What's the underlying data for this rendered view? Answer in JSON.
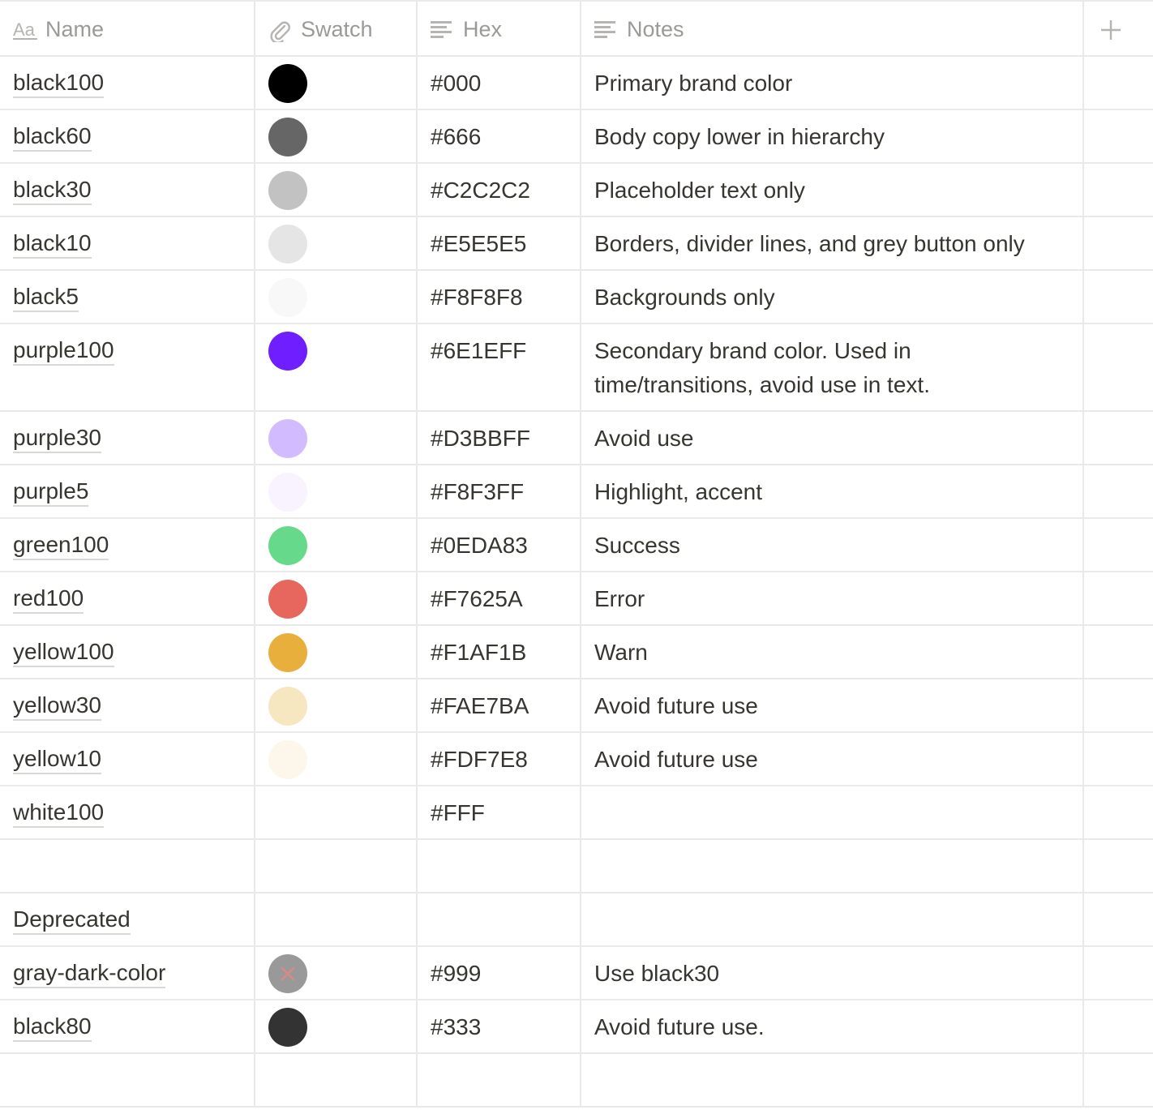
{
  "columns": {
    "name": "Name",
    "swatch": "Swatch",
    "hex": "Hex",
    "notes": "Notes"
  },
  "icons": {
    "name": "text-type-icon",
    "swatch": "paperclip-icon",
    "hex": "text-lines-icon",
    "notes": "text-lines-icon",
    "add": "plus-icon"
  },
  "rows": [
    {
      "name": "black100",
      "hex": "#000",
      "notes": "Primary brand color",
      "swatch": "#000000"
    },
    {
      "name": "black60",
      "hex": "#666",
      "notes": "Body copy lower in hierarchy",
      "swatch": "#666666"
    },
    {
      "name": "black30",
      "hex": "#C2C2C2",
      "notes": "Placeholder text only",
      "swatch": "#C2C2C2"
    },
    {
      "name": "black10",
      "hex": "#E5E5E5",
      "notes": "Borders, divider lines, and grey button only",
      "swatch": "#E5E5E5"
    },
    {
      "name": "black5",
      "hex": "#F8F8F8",
      "notes": "Backgrounds only",
      "swatch": "#F8F8F8"
    },
    {
      "name": "purple100",
      "hex": "#6E1EFF",
      "notes_line1": "Secondary brand color. Used in",
      "notes_line2": "time/transitions, avoid use in text.",
      "swatch": "#6E1EFF"
    },
    {
      "name": "purple30",
      "hex": "#D3BBFF",
      "notes": "Avoid use",
      "swatch": "#D3BBFF"
    },
    {
      "name": "purple5",
      "hex": "#F8F3FF",
      "notes": "Highlight, accent",
      "swatch": "#F8F3FF"
    },
    {
      "name": "green100",
      "hex": "#0EDA83",
      "notes": "Success",
      "swatch": "#66D98B"
    },
    {
      "name": "red100",
      "hex": "#F7625A",
      "notes": "Error",
      "swatch": "#E7675F"
    },
    {
      "name": "yellow100",
      "hex": "#F1AF1B",
      "notes": "Warn",
      "swatch": "#E9AF3C"
    },
    {
      "name": "yellow30",
      "hex": "#FAE7BA",
      "notes": "Avoid future use",
      "swatch": "#F7E7C1"
    },
    {
      "name": "yellow10",
      "hex": "#FDF7E8",
      "notes": "Avoid future use",
      "swatch": "#FCF7EA"
    },
    {
      "name": "white100",
      "hex": "#FFF",
      "notes": ""
    },
    {
      "name": "",
      "hex": "",
      "notes": ""
    },
    {
      "name": "Deprecated",
      "hex": "",
      "notes": ""
    },
    {
      "name": "gray-dark-color",
      "hex": "#999",
      "notes": "Use black30",
      "swatch": "#999999"
    },
    {
      "name": "black80",
      "hex": "#333",
      "notes": "Avoid future use.",
      "swatch": "#333333"
    },
    {
      "name": "",
      "hex": "",
      "notes": ""
    }
  ]
}
